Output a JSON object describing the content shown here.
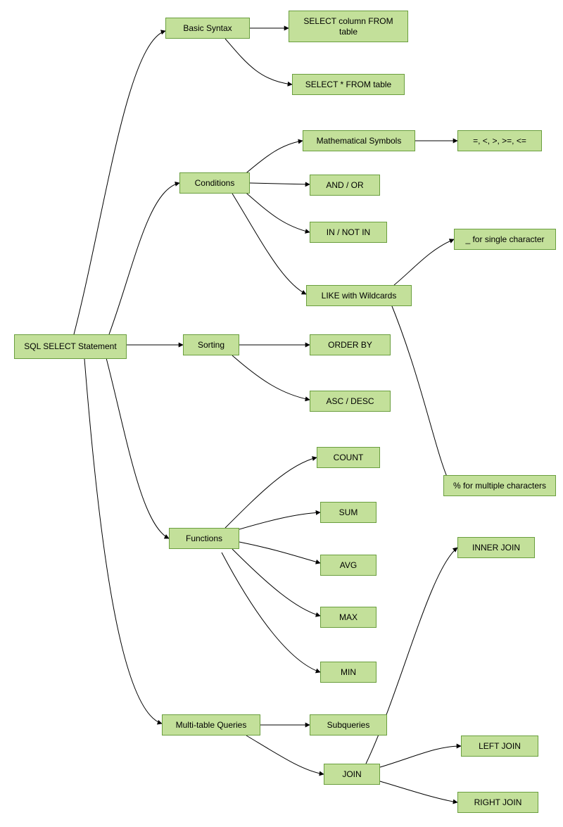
{
  "chart_data": {
    "type": "tree-diagram",
    "title": "",
    "nodes": {
      "root": "SQL SELECT Statement",
      "basic_syntax": "Basic Syntax",
      "select_col": "SELECT column FROM table",
      "select_star": "SELECT * FROM table",
      "conditions": "Conditions",
      "math_symbols": "Mathematical Symbols",
      "symbols_list": "=, <, >, >=, <=",
      "and_or": "AND / OR",
      "in_notin": "IN / NOT IN",
      "like": "LIKE with Wildcards",
      "underscore": "_ for single character",
      "percent": "% for multiple characters",
      "sorting": "Sorting",
      "order_by": "ORDER BY",
      "asc_desc": "ASC / DESC",
      "functions": "Functions",
      "count": "COUNT",
      "sum": "SUM",
      "avg": "AVG",
      "max": "MAX",
      "min": "MIN",
      "multi_table": "Multi-table Queries",
      "subqueries": "Subqueries",
      "join": "JOIN",
      "inner_join": "INNER JOIN",
      "left_join": "LEFT JOIN",
      "right_join": "RIGHT JOIN"
    },
    "edges": [
      [
        "root",
        "basic_syntax"
      ],
      [
        "basic_syntax",
        "select_col"
      ],
      [
        "basic_syntax",
        "select_star"
      ],
      [
        "root",
        "conditions"
      ],
      [
        "conditions",
        "math_symbols"
      ],
      [
        "math_symbols",
        "symbols_list"
      ],
      [
        "conditions",
        "and_or"
      ],
      [
        "conditions",
        "in_notin"
      ],
      [
        "conditions",
        "like"
      ],
      [
        "like",
        "underscore"
      ],
      [
        "like",
        "percent"
      ],
      [
        "root",
        "sorting"
      ],
      [
        "sorting",
        "order_by"
      ],
      [
        "sorting",
        "asc_desc"
      ],
      [
        "root",
        "functions"
      ],
      [
        "functions",
        "count"
      ],
      [
        "functions",
        "sum"
      ],
      [
        "functions",
        "avg"
      ],
      [
        "functions",
        "max"
      ],
      [
        "functions",
        "min"
      ],
      [
        "root",
        "multi_table"
      ],
      [
        "multi_table",
        "subqueries"
      ],
      [
        "multi_table",
        "join"
      ],
      [
        "join",
        "inner_join"
      ],
      [
        "join",
        "left_join"
      ],
      [
        "join",
        "right_join"
      ]
    ]
  }
}
